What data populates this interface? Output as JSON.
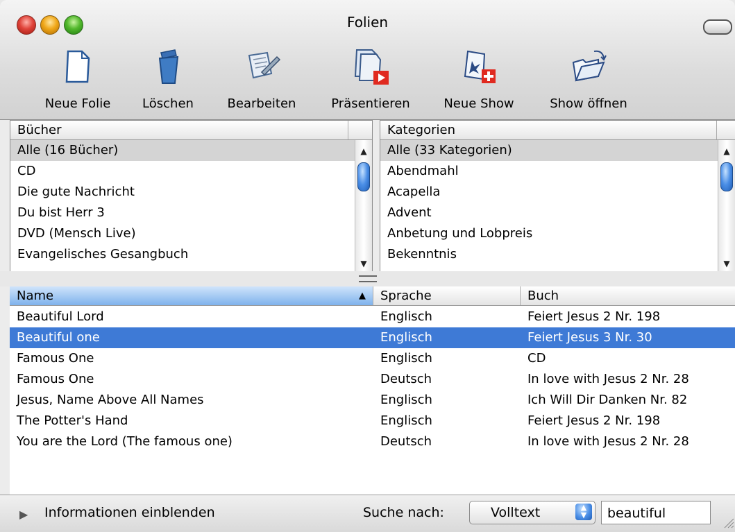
{
  "window": {
    "title": "Folien"
  },
  "toolbar": {
    "items": [
      {
        "label": "Neue Folie",
        "icon": "new-slide-icon"
      },
      {
        "label": "Löschen",
        "icon": "trash-icon"
      },
      {
        "label": "Bearbeiten",
        "icon": "edit-icon"
      },
      {
        "label": "Präsentieren",
        "icon": "present-icon"
      },
      {
        "label": "Neue Show",
        "icon": "new-show-icon"
      },
      {
        "label": "Show öffnen",
        "icon": "open-show-icon"
      }
    ]
  },
  "books": {
    "header": "Bücher",
    "items": [
      "Alle (16 Bücher)",
      "CD",
      "Die gute Nachricht",
      "Du bist Herr 3",
      "DVD (Mensch Live)",
      "Evangelisches Gesangbuch"
    ],
    "selected_index": 0
  },
  "categories": {
    "header": "Kategorien",
    "items": [
      "Alle (33 Kategorien)",
      "Abendmahl",
      "Acapella",
      "Advent",
      "Anbetung und Lobpreis",
      "Bekenntnis"
    ],
    "selected_index": 0
  },
  "songs": {
    "columns": [
      "Name",
      "Sprache",
      "Buch"
    ],
    "sorted_column": "Name",
    "rows": [
      {
        "name": "Beautiful Lord",
        "language": "Englisch",
        "book": "Feiert Jesus 2 Nr. 198"
      },
      {
        "name": "Beautiful one",
        "language": "Englisch",
        "book": "Feiert Jesus 3 Nr. 30"
      },
      {
        "name": "Famous One",
        "language": "Englisch",
        "book": "CD"
      },
      {
        "name": "Famous One",
        "language": "Deutsch",
        "book": "In love with Jesus 2 Nr. 28"
      },
      {
        "name": "Jesus, Name Above All Names",
        "language": "Englisch",
        "book": "Ich Will Dir Danken Nr. 82"
      },
      {
        "name": "The Potter's Hand",
        "language": "Englisch",
        "book": "Feiert Jesus 2 Nr. 198"
      },
      {
        "name": "You are the Lord (The famous one)",
        "language": "Deutsch",
        "book": "In love with Jesus 2 Nr. 28"
      }
    ],
    "selected_index": 1
  },
  "bottom": {
    "info_toggle": "Informationen einblenden",
    "search_label": "Suche nach:",
    "search_mode": "Volltext",
    "search_value": "beautiful"
  },
  "colors": {
    "selection": "#3e7ad6",
    "inactive_selection": "#d4d4d4"
  }
}
